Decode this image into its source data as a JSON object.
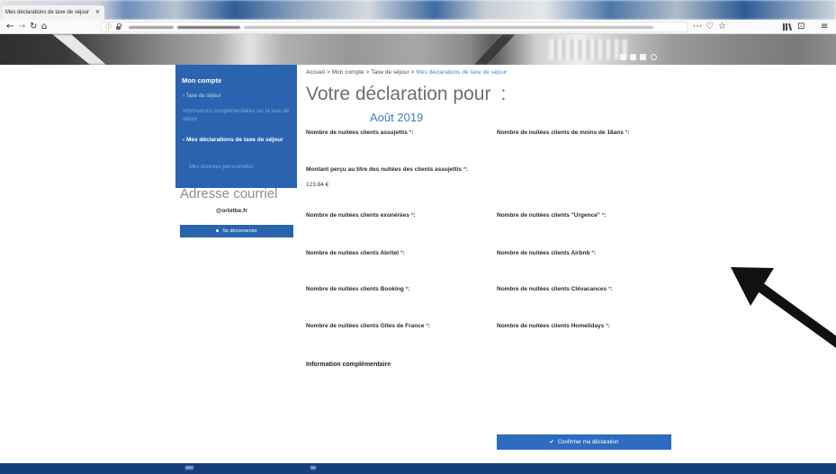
{
  "browser": {
    "tab_title": "Mes déclarations de taxe de séjour",
    "tab_close": "✕",
    "nav": {
      "back": "←",
      "forward": "→",
      "reload": "↻",
      "home": "⌂"
    },
    "url_info": "ⓘ",
    "page_actions": {
      "more": "⋯",
      "pocket": "♡",
      "bookmark": "☆"
    },
    "toolbar": {
      "sidebar": "⊡",
      "menu": "≡"
    },
    "icons": [
      "back-arrow-icon",
      "forward-arrow-icon",
      "reload-icon",
      "home-icon",
      "info-icon",
      "lock-icon",
      "more-icon",
      "pocket-icon",
      "bookmark-star-icon",
      "library-icon",
      "sidebar-icon",
      "menu-icon"
    ]
  },
  "header": {
    "social_icons": [
      "linkedin-icon",
      "facebook-icon",
      "twitter-icon",
      "search-icon"
    ]
  },
  "sidebar": {
    "title": "Mon compte",
    "items": [
      {
        "label": "› Taxe de séjour"
      },
      {
        "label": "Informations complémentaires sur la taxe de séjour"
      },
      {
        "label": "› Mes déclarations de taxe de séjour",
        "active": true
      },
      {
        "label": "Mes données personnelles"
      }
    ]
  },
  "account": {
    "email_heading": "Adresse courriel",
    "email": "@orbitbe.fr",
    "button_label": "Se déconnecter"
  },
  "page": {
    "breadcrumb": [
      {
        "label": "Accueil"
      },
      {
        "label": "Mon compte"
      },
      {
        "label": "Taxe de séjour"
      },
      {
        "label": "Mes déclarations de taxe de séjour",
        "current": true
      }
    ],
    "breadcrumb_separator": ">",
    "title": "Votre déclaration pour",
    "title_suffix": ":",
    "period": "Août 2019"
  },
  "form": {
    "required_mark": "*",
    "colon": ":",
    "left_fields": [
      {
        "label": "Nombre de nuitées clients assujettis",
        "value": ""
      },
      {
        "label": "Montant perçu au titre des nuitées des clients assujettis",
        "value": "123.84 €"
      },
      {
        "label": "Nombre de nuitées clients exonérées",
        "value": ""
      },
      {
        "label": "Nombre de nuitées clients Abritel",
        "value": ""
      },
      {
        "label": "Nombre de nuitées clients Booking",
        "value": ""
      },
      {
        "label": "Nombre de nuitées clients Gîtes de France",
        "value": ""
      }
    ],
    "right_fields": [
      {
        "label": "Nombre de nuitées clients de moins de 18ans",
        "value": ""
      },
      {
        "label": "Nombre de nuitées clients \"Urgence\"",
        "value": ""
      },
      {
        "label": "Nombre de nuitées clients Airbnb",
        "value": ""
      },
      {
        "label": "Nombre de nuitées clients Clévacances",
        "value": ""
      },
      {
        "label": "Nombre de nuitées clients Homelidays",
        "value": ""
      }
    ],
    "info_label": "Information complémentaire",
    "info_value": "",
    "submit_icon": "✔",
    "submit_label": "Confirmer ma déclaration"
  },
  "theme": {
    "accent": "#2a63b0",
    "required": "#e32b3c",
    "period": "#3f7ec9",
    "footer": "#163e7a",
    "annotation": "#111111"
  }
}
